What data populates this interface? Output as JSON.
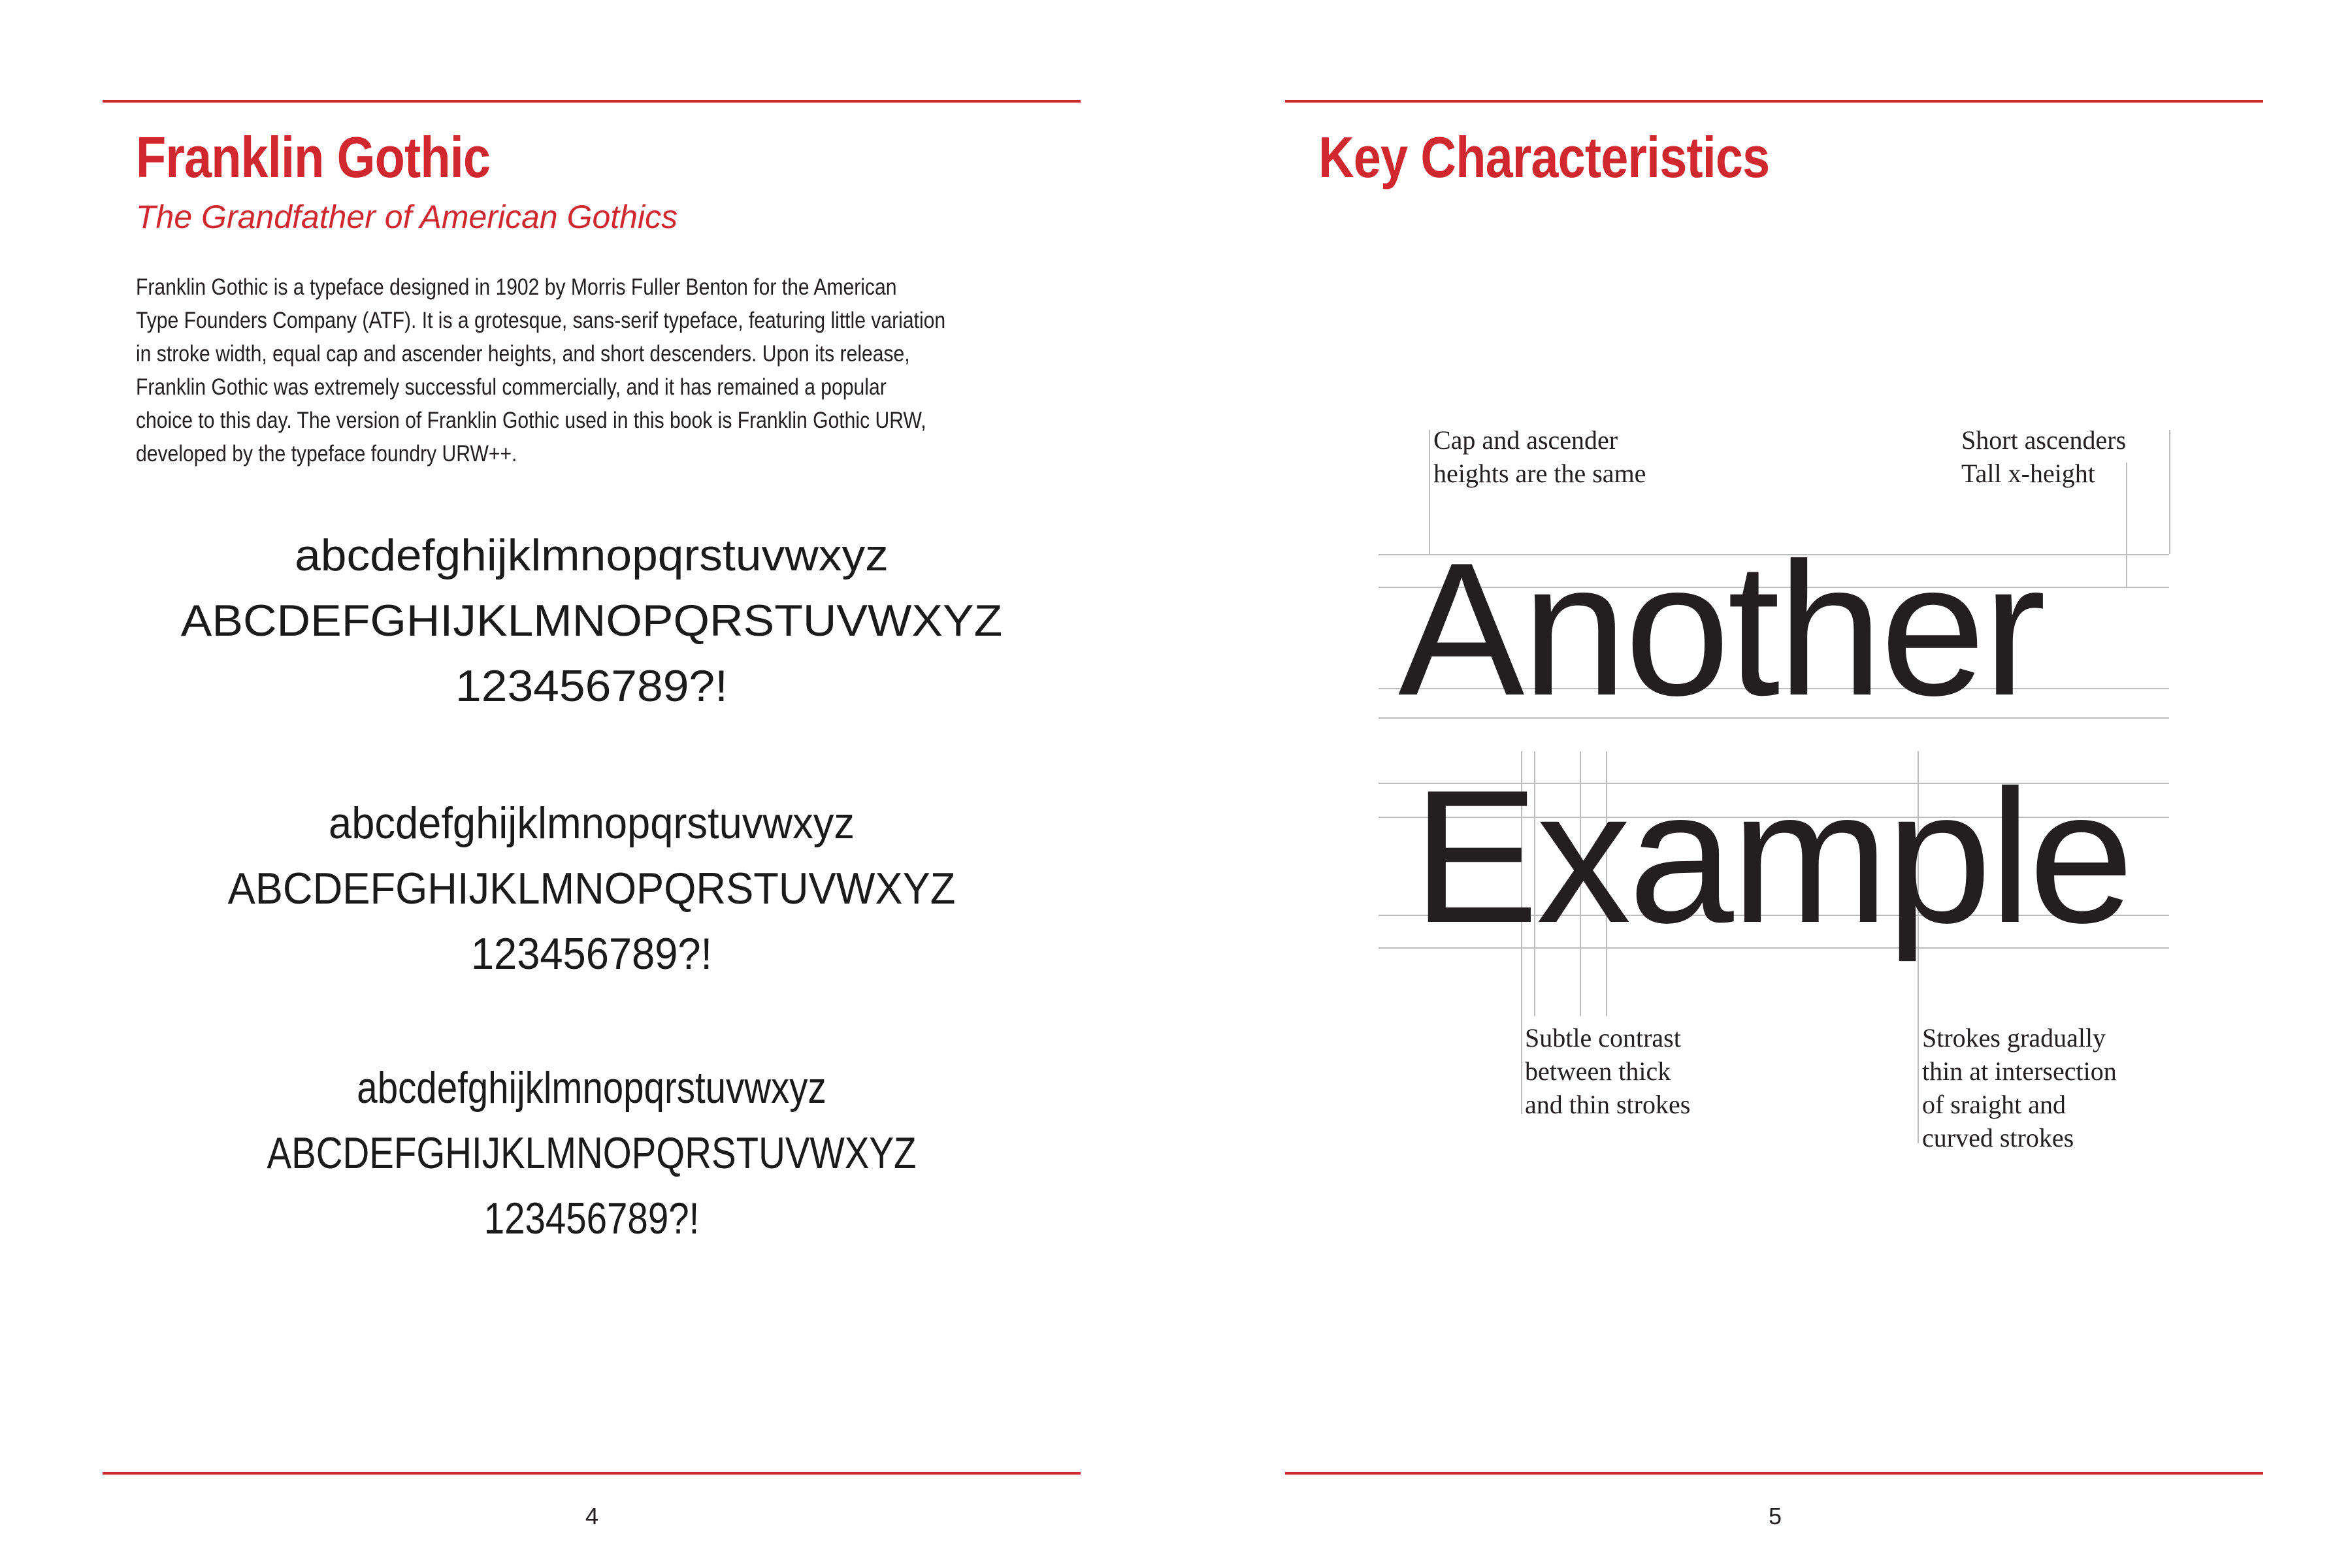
{
  "left_page": {
    "title": "Franklin Gothic",
    "subtitle": "The Grandfather of American Gothics",
    "body_lines": [
      "Franklin Gothic is a typeface designed in 1902 by Morris Fuller Benton for the American",
      "Type Founders Company (ATF). It is a grotesque, sans-serif typeface, featuring little variation",
      "in stroke width, equal cap and ascender heights, and short descenders. Upon its release,",
      "Franklin Gothic was extremely successful commercially, and it has remained a popular",
      "choice to this day. The version of Franklin Gothic used in this book is Franklin Gothic URW,",
      "developed by the typeface foundry URW++."
    ],
    "specimens": [
      {
        "lower": "abcdefghijklmnopqrstuvwxyz",
        "upper": "ABCDEFGHIJKLMNOPQRSTUVWXYZ",
        "digits": "123456789?!"
      },
      {
        "lower": "abcdefghijklmnopqrstuvwxyz",
        "upper": "ABCDEFGHIJKLMNOPQRSTUVWXYZ",
        "digits": "123456789?!"
      },
      {
        "lower": "abcdefghijklmnopqrstuvwxyz",
        "upper": "ABCDEFGHIJKLMNOPQRSTUVWXYZ",
        "digits": "123456789?!"
      }
    ],
    "page_number": "4"
  },
  "right_page": {
    "title": "Key Characteristics",
    "word_1": "Another",
    "word_2": "Example",
    "annotations": {
      "top_left": [
        "Cap and ascender",
        "heights are the same"
      ],
      "top_right": [
        "Short ascenders",
        "Tall x-height"
      ],
      "bottom_left": [
        "Subtle contrast",
        "between thick",
        "and thin strokes"
      ],
      "bottom_right": [
        "Strokes gradually",
        "thin at intersection",
        "of sraight and",
        "curved strokes"
      ]
    },
    "page_number": "5"
  },
  "colors": {
    "accent_red": "#d0282e",
    "text": "#231f20",
    "guide": "#bdbdbd"
  }
}
